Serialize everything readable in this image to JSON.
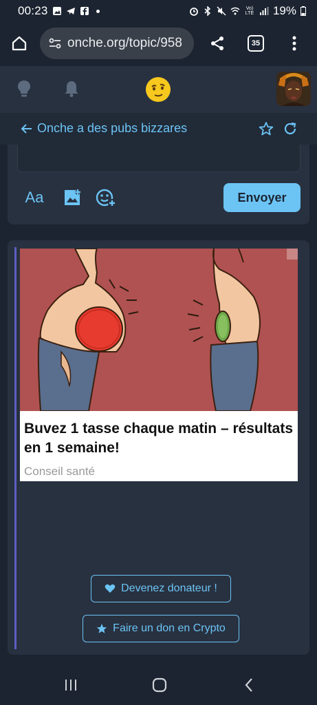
{
  "status_bar": {
    "time": "00:23",
    "battery": "19%",
    "network_label": "Vo) LTE"
  },
  "browser": {
    "url": "onche.org/topic/958",
    "tab_count": "35"
  },
  "topic": {
    "title": "Onche a des pubs bizzares"
  },
  "composer": {
    "format_label": "Aa",
    "send_label": "Envoyer"
  },
  "ad": {
    "headline": "Buvez 1 tasse chaque matin – résultats en 1 semaine!",
    "source": "Conseil santé"
  },
  "donate": {
    "donor_label": "Devenez donateur !",
    "crypto_label": "Faire un don en Crypto"
  },
  "colors": {
    "background": "#1c2431",
    "panel": "#283140",
    "accent": "#6cc4f5",
    "ad_image_bg": "#b05251"
  },
  "icons": [
    "home-icon",
    "site-info-icon",
    "share-icon",
    "menu-icon",
    "lightbulb-icon",
    "bell-icon",
    "emoji-logo-icon",
    "back-arrow-icon",
    "star-icon",
    "refresh-icon",
    "add-image-icon",
    "add-emoji-icon",
    "heart-icon",
    "recent-apps-icon",
    "home-nav-icon",
    "back-nav-icon"
  ]
}
